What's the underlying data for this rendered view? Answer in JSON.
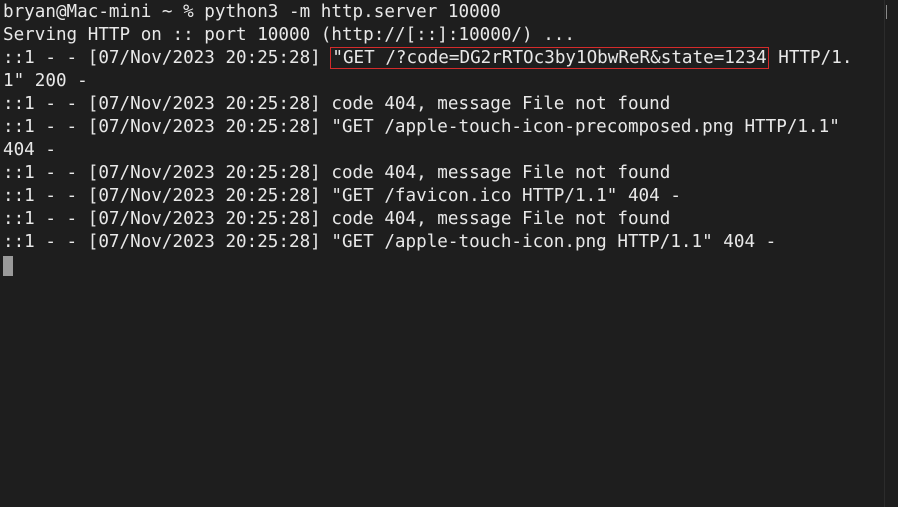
{
  "terminal": {
    "prompt": "bryan@Mac-mini ~ % python3 -m http.server 10000",
    "serving": "Serving HTTP on :: port 10000 (http://[::]:10000/) ...",
    "log1_prefix": "::1 - - [07/Nov/2023 20:25:28] ",
    "log1_highlight": "\"GET /?code=DG2rRTOc3by1ObwReR&state=1234",
    "log1_suffix": " HTTP/1.",
    "log1_wrap": "1\" 200 -",
    "log2": "::1 - - [07/Nov/2023 20:25:28] code 404, message File not found",
    "log3": "::1 - - [07/Nov/2023 20:25:28] \"GET /apple-touch-icon-precomposed.png HTTP/1.1\"",
    "log3_wrap": "404 -",
    "log4": "::1 - - [07/Nov/2023 20:25:28] code 404, message File not found",
    "log5": "::1 - - [07/Nov/2023 20:25:28] \"GET /favicon.ico HTTP/1.1\" 404 -",
    "log6": "::1 - - [07/Nov/2023 20:25:28] code 404, message File not found",
    "log7": "::1 - - [07/Nov/2023 20:25:28] \"GET /apple-touch-icon.png HTTP/1.1\" 404 -"
  },
  "colors": {
    "background": "#1e1e1e",
    "text": "#e8e8e8",
    "highlight_border": "#d42b2b",
    "cursor": "#9a9a9a"
  }
}
